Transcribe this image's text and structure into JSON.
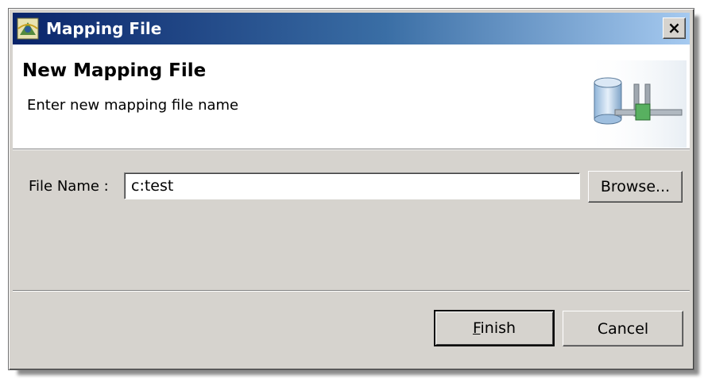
{
  "window": {
    "title": "Mapping File",
    "close_label": "×"
  },
  "banner": {
    "title": "New Mapping File",
    "description": "Enter new mapping file name"
  },
  "form": {
    "file_name_label": "File Name :",
    "file_name_value": "c:test",
    "browse_label": "Browse..."
  },
  "buttons": {
    "finish_mnemonic": "F",
    "finish_rest": "inish",
    "cancel_label": "Cancel"
  },
  "icons": {
    "app_icon": "eclipse-wizard-icon",
    "banner_graphic": "database-mapping-icon",
    "close_icon": "close-icon"
  }
}
